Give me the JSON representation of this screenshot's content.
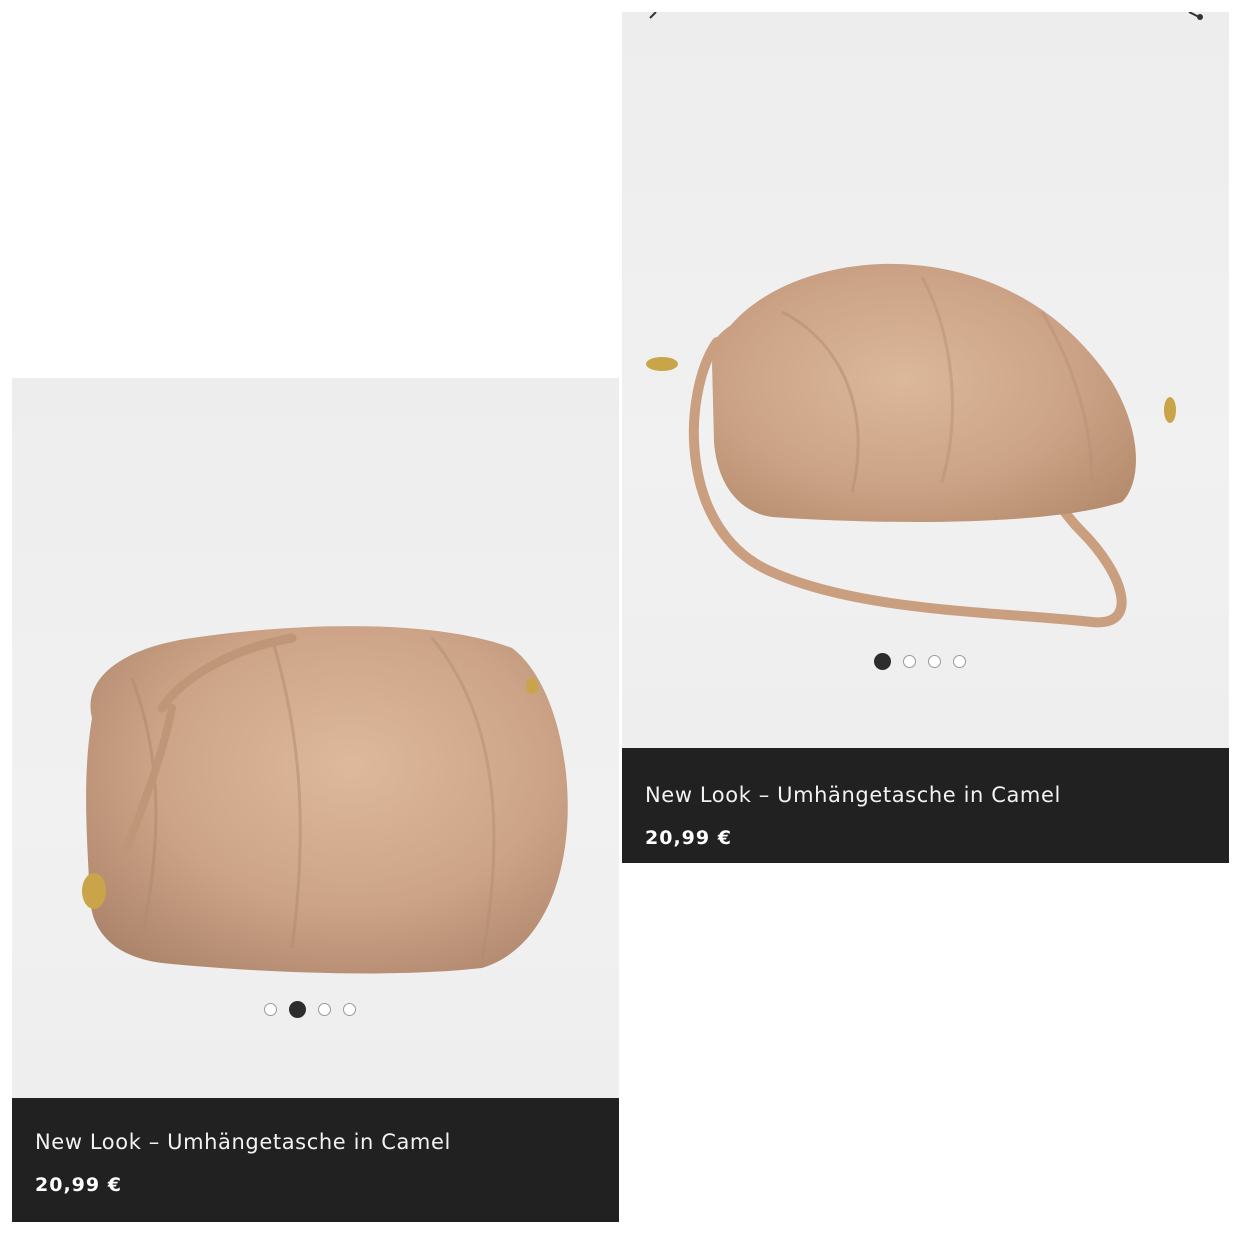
{
  "products": [
    {
      "id": "right",
      "title": "New Look – Umhängetasche in Camel",
      "price": "20,99 €",
      "carousel": {
        "total": 4,
        "active": 0
      },
      "image_alt": "camel crossbody pouch bag with strap, front view"
    },
    {
      "id": "left",
      "title": "New Look – Umhängetasche in Camel",
      "price": "20,99 €",
      "carousel": {
        "total": 4,
        "active": 1
      },
      "image_alt": "camel pouch bag, angled side view"
    }
  ],
  "colors": {
    "info_bar": "#212121",
    "photo_bg": "#efefef",
    "bag": "#cfa98a",
    "dot_active": "#2d2d2d"
  },
  "icons": [
    "back-arrow-icon",
    "share-icon"
  ]
}
